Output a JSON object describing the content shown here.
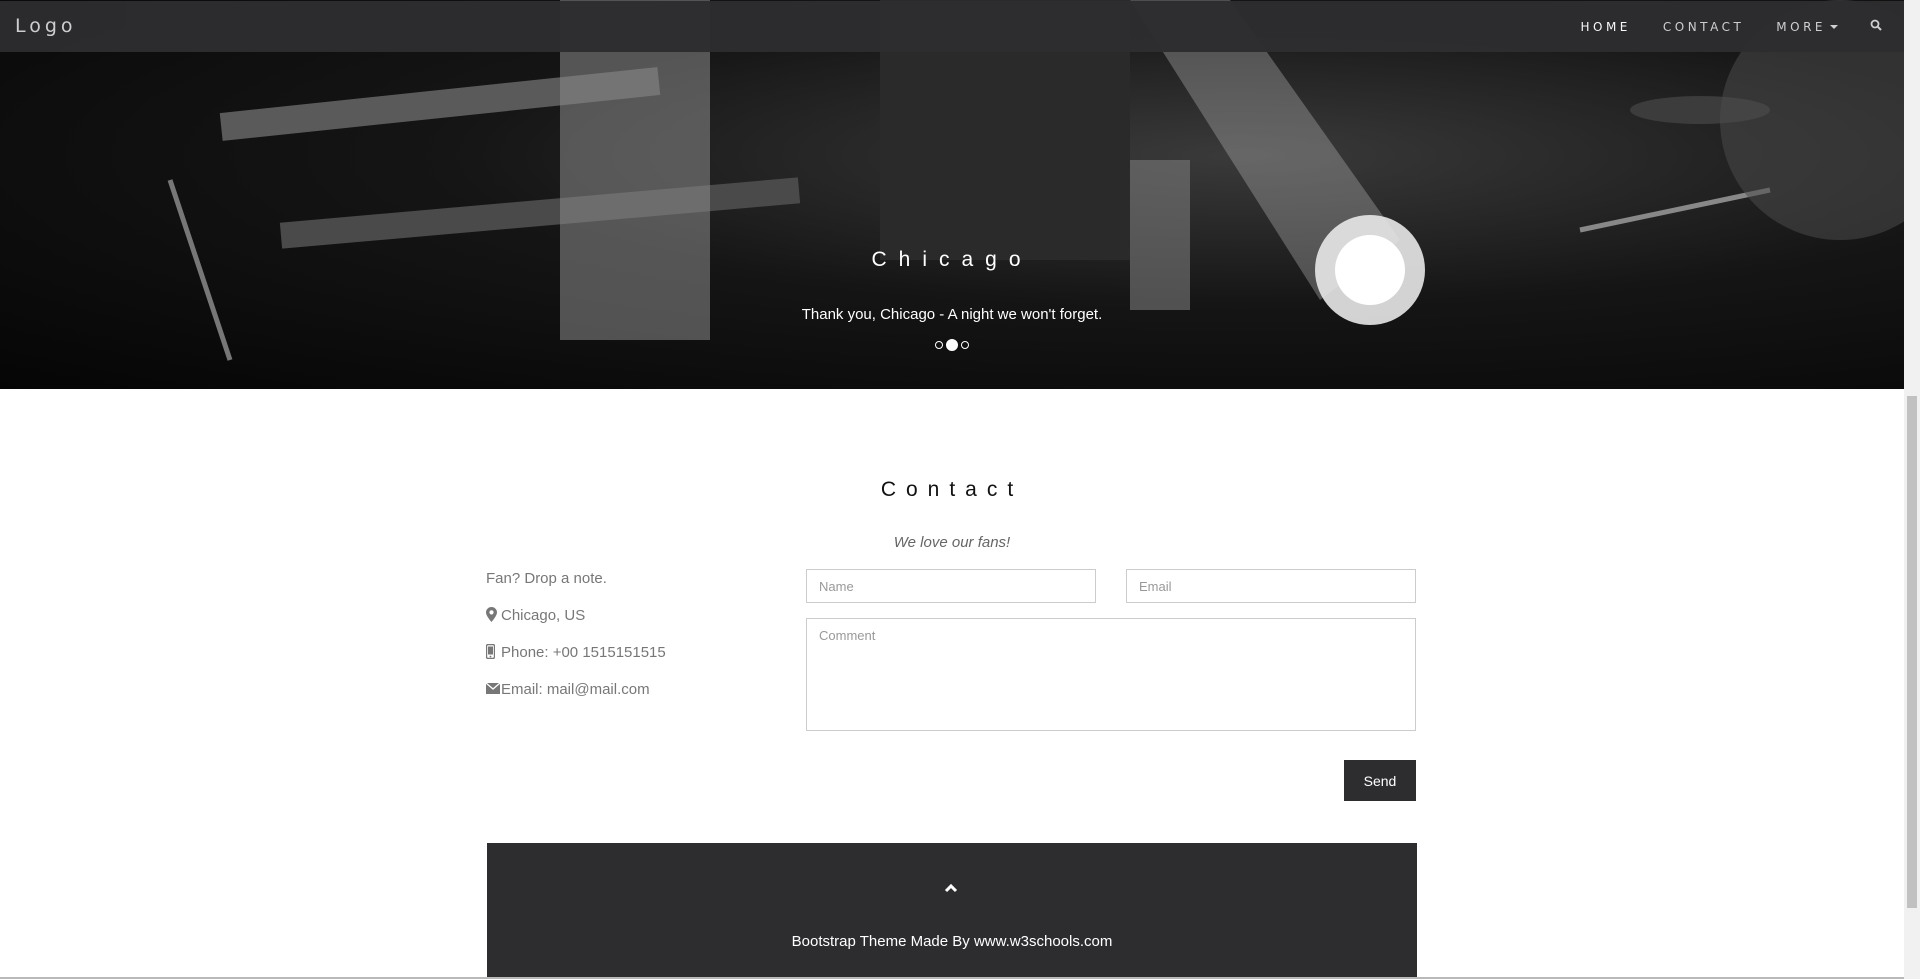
{
  "navbar": {
    "logo": "Logo",
    "items": [
      {
        "label": "HOME",
        "active": true
      },
      {
        "label": "CONTACT",
        "active": false
      },
      {
        "label": "MORE",
        "active": false
      }
    ],
    "search_icon": "search-icon"
  },
  "hero": {
    "title": "Chicago",
    "caption": "Thank you, Chicago - A night we won't forget.",
    "indicators": 3,
    "active_indicator": 2
  },
  "contact": {
    "title": "Contact",
    "subtitle": "We love our fans!",
    "info": {
      "note": "Fan? Drop a note.",
      "location": "Chicago, US",
      "phone": "Phone: +00 1515151515",
      "email": "Email: mail@mail.com"
    },
    "form": {
      "name_placeholder": "Name",
      "email_placeholder": "Email",
      "comment_placeholder": "Comment",
      "send_label": "Send"
    }
  },
  "footer": {
    "text_prefix": "Bootstrap Theme Made By ",
    "link_text": "www.w3schools.com"
  },
  "colors": {
    "dark": "#2d2d30",
    "text": "#777777",
    "white": "#ffffff"
  }
}
